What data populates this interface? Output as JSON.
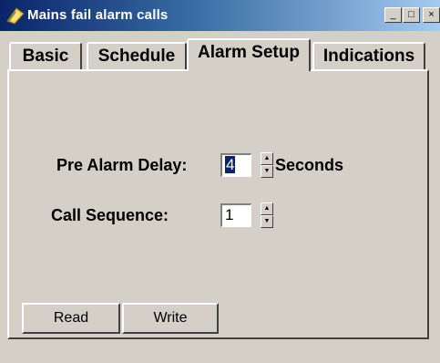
{
  "window": {
    "title": "Mains fail alarm calls",
    "minimize_glyph": "_",
    "maximize_glyph": "□",
    "close_glyph": "×"
  },
  "tabs": [
    {
      "label": "Basic",
      "active": false
    },
    {
      "label": "Schedule",
      "active": false
    },
    {
      "label": "Alarm Setup",
      "active": true
    },
    {
      "label": "Indications",
      "active": false
    }
  ],
  "alarm_setup": {
    "pre_alarm_delay": {
      "label": "Pre Alarm Delay:",
      "value": "4",
      "unit": "Seconds"
    },
    "call_sequence": {
      "label": "Call Sequence:",
      "value": "1"
    }
  },
  "spin": {
    "up_glyph": "▲",
    "down_glyph": "▼"
  },
  "buttons": {
    "read": "Read",
    "write": "Write"
  },
  "colors": {
    "titlebar_start": "#0a246a",
    "titlebar_end": "#a6caf0",
    "face": "#d4d0c8",
    "selection": "#0a246a"
  }
}
